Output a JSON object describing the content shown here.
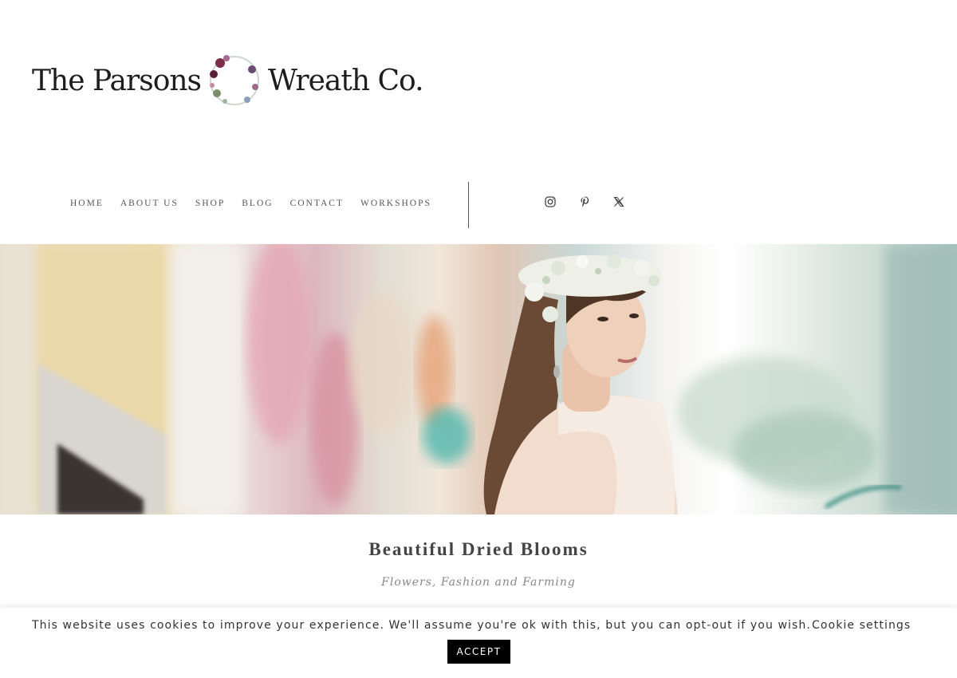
{
  "logo": {
    "word_left": "The Parsons",
    "word_right": "Wreath Co."
  },
  "nav": {
    "items": [
      {
        "label": "HOME"
      },
      {
        "label": "ABOUT US"
      },
      {
        "label": "SHOP"
      },
      {
        "label": "BLOG"
      },
      {
        "label": "CONTACT"
      },
      {
        "label": "WORKSHOPS"
      }
    ]
  },
  "social": {
    "icons": [
      "instagram-icon",
      "pinterest-icon",
      "x-twitter-icon"
    ]
  },
  "hero": {
    "title": "Beautiful Dried Blooms",
    "tagline": "Flowers, Fashion and Farming"
  },
  "cookie": {
    "message": "This website uses cookies to improve your experience. We'll assume you're ok with this, but you can opt-out if you wish.",
    "settings_label": "Cookie settings",
    "accept_label": "ACCEPT"
  }
}
